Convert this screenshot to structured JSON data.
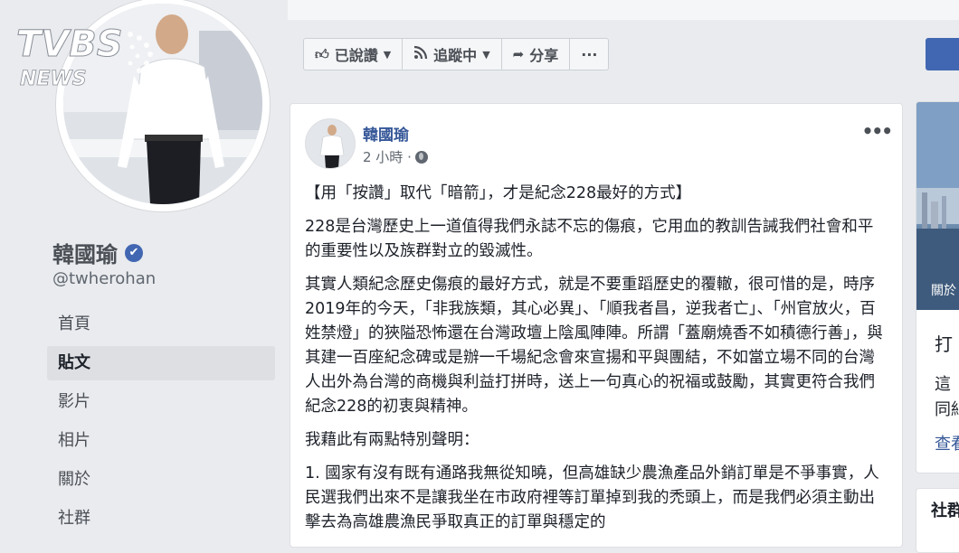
{
  "watermark": {
    "logo_text_1": "TVBS",
    "logo_text_2": "NEWS"
  },
  "profile": {
    "name": "韓國瑜",
    "handle": "@twherohan"
  },
  "nav": [
    {
      "label": "首頁",
      "active": false
    },
    {
      "label": "貼文",
      "active": true
    },
    {
      "label": "影片",
      "active": false
    },
    {
      "label": "相片",
      "active": false
    },
    {
      "label": "關於",
      "active": false
    },
    {
      "label": "社群",
      "active": false
    }
  ],
  "action_bar": {
    "liked_label": "已說讚",
    "follow_label": "追蹤中",
    "share_label": "分享",
    "more_label": "···"
  },
  "post": {
    "author": "韓國瑜",
    "time": "2 小時 ·",
    "more": "•••",
    "title": "【用「按讚」取代「暗箭」，才是紀念228最好的方式】",
    "p1": "228是台灣歷史上一道值得我們永誌不忘的傷痕，它用血的教訓告誡我們社會和平的重要性以及族群對立的毀滅性。",
    "p2": "其實人類紀念歷史傷痕的最好方式，就是不要重蹈歷史的覆轍，很可惜的是，時序2019年的今天，「非我族類，其心必異」、「順我者昌，逆我者亡」、「州官放火，百姓禁燈」的狹隘恐怖還在台灣政壇上陰風陣陣。所謂「蓋廟燒香不如積德行善」，與其建一百座紀念碑或是辦一千場紀念會來宣揚和平與團結，不如當立場不同的台灣人出外為台灣的商機與利益打拼時，送上一句真心的祝福或鼓勵，其實更符合我們紀念228的初衷與精神。",
    "p3": "我藉此有兩點特別聲明：",
    "p4": "1. 國家有沒有既有通路我無從知曉，但高雄缺少農漁產品外銷訂單是不爭事實，人民選我們出來不是讓我坐在市政府裡等訂單掉到我的禿頭上，而是我們必須主動出擊去為高雄農漁民爭取真正的訂單與穩定的"
  },
  "right_panel": {
    "img_caption": "關於",
    "line1": "打",
    "line2": "這",
    "line3": "同絲",
    "line4": "查看",
    "card2_heading": "社群"
  },
  "colors": {
    "facebook_blue": "#4267b2",
    "link_blue": "#365899",
    "page_bg": "#e9ebee"
  }
}
